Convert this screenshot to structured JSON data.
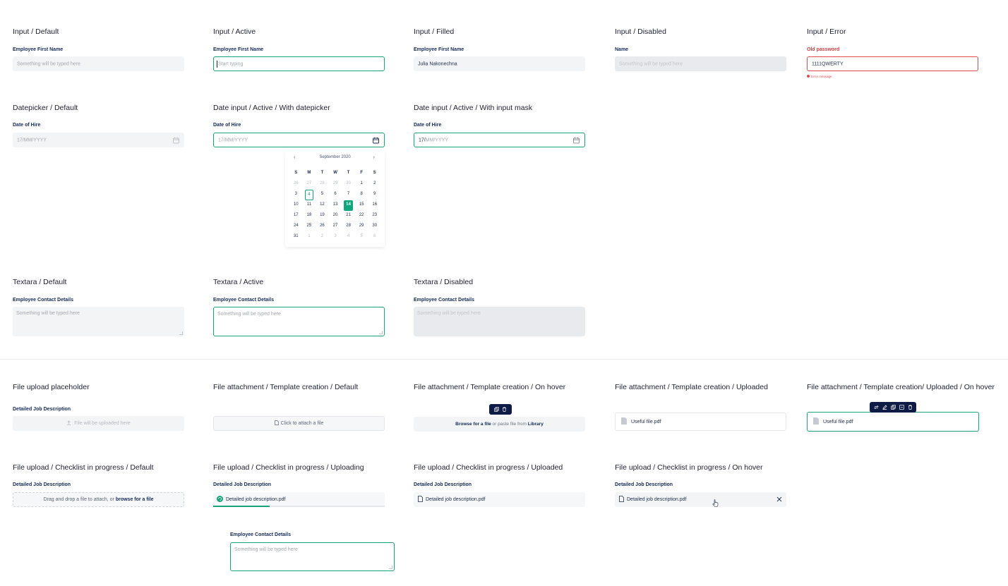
{
  "colors": {
    "accent": "#19a37a",
    "error": "#e5484d",
    "navy": "#0d1b45",
    "field_bg": "#f3f4f6"
  },
  "inputs": {
    "default": {
      "title": "Input / Default",
      "label": "Employee First Name",
      "placeholder": "Something will be typed here"
    },
    "active": {
      "title": "Input / Active",
      "label": "Employee First Name",
      "placeholder": "Start typing"
    },
    "filled": {
      "title": "Input / Filled",
      "label": "Employee First Name",
      "value": "Julia Nakonechna"
    },
    "disabled": {
      "title": "Input / Disabled",
      "label": "Name",
      "placeholder": "Something will be typed here"
    },
    "error": {
      "title": "Input / Error",
      "label": "Old password",
      "value": "1111QWERTY",
      "error_message": "Error message"
    }
  },
  "dates": {
    "default": {
      "title": "Datepicker / Default",
      "label": "Date of Hire",
      "placeholder": "17/MM/YYYY",
      "icon": "calendar-icon"
    },
    "with_datepicker": {
      "title": "Date input / Active / With datepicker",
      "label": "Date of Hire",
      "placeholder": "17/MM/YYYY",
      "icon": "calendar-icon"
    },
    "input_mask": {
      "title": "Date input / Active / With input mask",
      "label": "Date of Hire",
      "typed": "17/",
      "mask": "MM/YYYY",
      "icon": "calendar-icon"
    }
  },
  "calendar": {
    "month": "September 2020",
    "prev": "‹",
    "next": "›",
    "day_headers": [
      "S",
      "M",
      "T",
      "W",
      "T",
      "F",
      "S"
    ],
    "weeks": [
      [
        "26",
        "27",
        "28",
        "29",
        "30",
        "1",
        "2"
      ],
      [
        "3",
        "4",
        "5",
        "6",
        "7",
        "8",
        "9"
      ],
      [
        "10",
        "11",
        "12",
        "13",
        "14",
        "15",
        "16"
      ],
      [
        "17",
        "18",
        "19",
        "20",
        "21",
        "22",
        "23"
      ],
      [
        "24",
        "25",
        "26",
        "27",
        "28",
        "29",
        "30"
      ],
      [
        "31",
        "1",
        "2",
        "3",
        "4",
        "5",
        "6"
      ]
    ],
    "today": "4",
    "selected": "14"
  },
  "textareas": {
    "default": {
      "title": "Textara / Default",
      "label": "Employee Contact Details",
      "placeholder": "Something will be typed here"
    },
    "active": {
      "title": "Textara / Active",
      "label": "Employee Contact Details",
      "placeholder": "Something will be typed here"
    },
    "disabled": {
      "title": "Textara / Disabled",
      "label": "Employee Contact Details",
      "placeholder": "Something will be typed here"
    },
    "extra": {
      "label": "Employee Contact Details",
      "placeholder": "Something will be typed here"
    }
  },
  "file_attach": {
    "placeholder": {
      "title": "File upload placeholder",
      "label": "Detailed Job Description",
      "text": "File will be uploaded here",
      "icon": "upload-icon"
    },
    "template_default": {
      "title": "File attachment / Template creation / Default",
      "text": "Click to attach a file",
      "icon": "file-icon"
    },
    "template_hover": {
      "title": "File attachment / Template creation / On hover",
      "browse": "Browse for a file",
      "middle": " or paste file from ",
      "library": "Library",
      "toolbar_icons": [
        "copy-icon",
        "trash-icon"
      ]
    },
    "template_uploaded": {
      "title": "File attachment / Template creation / Uploaded",
      "file": "Useful file.pdf",
      "icon": "pdf-file-icon"
    },
    "template_uploaded_hover": {
      "title": "File attachment / Template creation/ Uploaded / On hover",
      "file": "Useful file.pdf",
      "toolbar_icons": [
        "replace-icon",
        "edit-icon",
        "copy-icon",
        "save-icon",
        "trash-icon"
      ]
    }
  },
  "checklist": {
    "default": {
      "title": "File upload / Checklist in progress / Default",
      "label": "Detailed Job Description",
      "text": "Drag and drop a file to attach, or ",
      "browse": "browse for a file"
    },
    "uploading": {
      "title": "File upload / Checklist in progress / Uploading",
      "label": "Detailed Job Description",
      "file": "Detailed job description.pdf",
      "progress": 0.33
    },
    "uploaded": {
      "title": "File upload / Checklist in progress / Uploaded",
      "label": "Detailed Job Description",
      "file": "Detailed job description.pdf"
    },
    "hover": {
      "title": "File upload / Checklist in progress / On hover",
      "label": "Detailed Job Description",
      "file": "Detailed job description.pdf",
      "icon": "close-icon"
    }
  }
}
